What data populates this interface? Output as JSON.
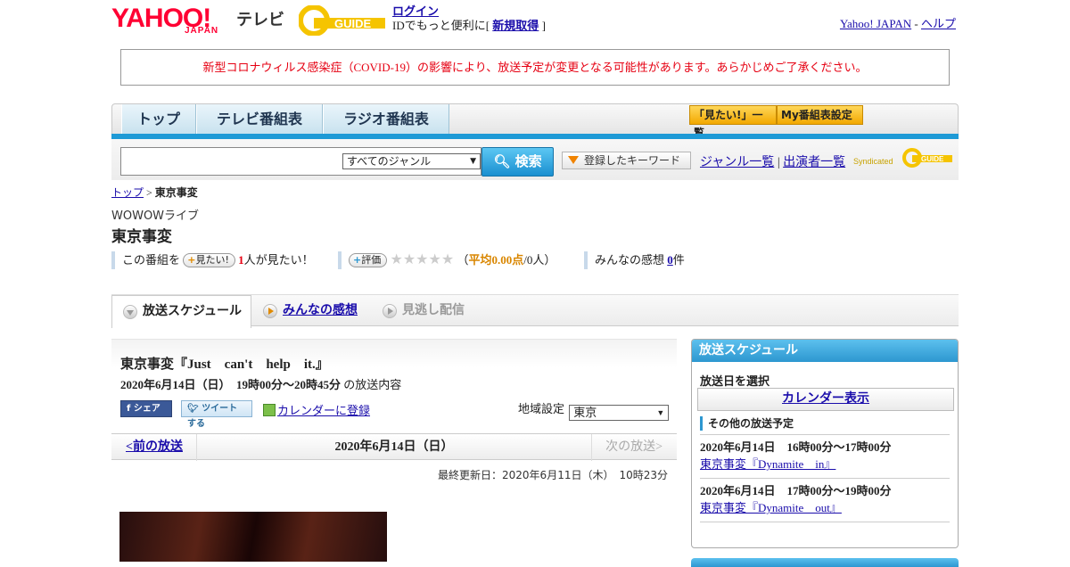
{
  "header": {
    "logo_yahoo": "YAHOO!",
    "logo_yahoo_sub": "JAPAN",
    "logo_tv": "テレビ",
    "logo_gguide": "GUIDE",
    "login_link": "ログイン",
    "login_text": "IDでもっと便利に[",
    "register_link": "新規取得",
    "login_text_end": "]",
    "yahoo_japan_link": "Yahoo! JAPAN",
    "separator": "-",
    "help_link": "ヘルプ"
  },
  "notice": "新型コロナウィルス感染症（COVID-19）の影響により、放送予定が変更となる可能性があります。あらかじめご了承ください。",
  "gnav": {
    "tabs": [
      "トップ",
      "テレビ番組表",
      "ラジオ番組表"
    ],
    "watchlist_button": "「見たい!」一覧",
    "my_schedule_button": "My番組表設定"
  },
  "search": {
    "placeholder": "",
    "genre_select": "すべてのジャンル",
    "search_button": "検索",
    "keyword_button": "登録したキーワード",
    "genre_list_link": "ジャンル一覧",
    "link_separator": "|",
    "performer_list_link": "出演者一覧",
    "syndicated_label": "Syndicated",
    "syndicated_logo": "GUIDE"
  },
  "breadcrumb": {
    "top_link": "トップ",
    "separator": ">",
    "current": "東京事変"
  },
  "program": {
    "channel": "WOWOWライブ",
    "title": "東京事変",
    "stats": {
      "want_prefix": "この番組を",
      "want_pill": "見たい!",
      "want_count": "1",
      "want_suffix": "人が見たい！",
      "rating_pill": "評価",
      "stars": "★★★★★",
      "rating_open": "（",
      "rating_avg": "平均0.00点",
      "rating_rest": "/0人）",
      "impressions_label": "みんなの感想",
      "impressions_count": "0",
      "impressions_unit": "件"
    }
  },
  "subtabs": [
    "放送スケジュール",
    "みんなの感想",
    "見逃し配信"
  ],
  "broadcast": {
    "title": "東京事変『Just　can't　help　it.』",
    "time": "2020年6月14日（日）　19時00分～20時45分",
    "time_suffix": "の放送内容",
    "facebook_button": "シェア",
    "tweet_button": "ツイートする",
    "calendar_register": "カレンダーに登録",
    "region_label": "地域設定",
    "region_value": "東京",
    "prev_link": "<前の放送",
    "current_date": "2020年6月14日（日）",
    "next_link": "次の放送>",
    "updated": "最終更新日：2020年6月11日（木）　10時23分"
  },
  "sidebar": {
    "header": "放送スケジュール",
    "select_date": "放送日を選択",
    "calendar_button": "カレンダー表示",
    "other_header": "その他の放送予定",
    "other_items": [
      {
        "time": "2020年6月14日　16時00分～17時00分",
        "title": "東京事変『Dynamite　in』"
      },
      {
        "time": "2020年6月14日　17時00分～19時00分",
        "title": "東京事変『Dynamite　out』"
      }
    ]
  },
  "colors": {
    "brand_red": "#ff0033",
    "notice_red": "#e60012",
    "accent_blue": "#1e9ad6",
    "gguide_yellow": "#f5c400"
  }
}
